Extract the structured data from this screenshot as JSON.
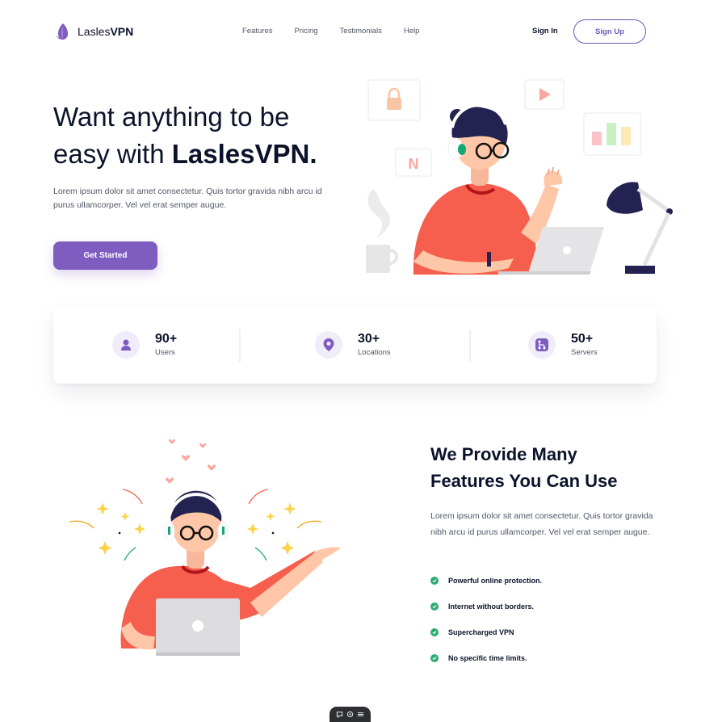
{
  "brand": {
    "name_light": "Lasles",
    "name_bold": "VPN",
    "color": "#7e5cc0"
  },
  "nav": {
    "items": [
      {
        "label": "Features"
      },
      {
        "label": "Pricing"
      },
      {
        "label": "Testimonials"
      },
      {
        "label": "Help"
      }
    ],
    "sign_in": "Sign In",
    "sign_up": "Sign Up"
  },
  "hero": {
    "title_line1": "Want anything to be",
    "title_line2_prefix": "easy with ",
    "title_line2_bold": "LaslesVPN.",
    "description": "Lorem ipsum dolor sit amet consectetur. Quis tortor gravida nibh arcu id purus ullamcorper. Vel vel erat semper augue.",
    "cta": "Get Started",
    "illustration_letter": "N"
  },
  "stats": [
    {
      "value": "90+",
      "label": "Users",
      "icon": "user-icon"
    },
    {
      "value": "30+",
      "label": "Locations",
      "icon": "location-icon"
    },
    {
      "value": "50+",
      "label": "Servers",
      "icon": "server-icon"
    }
  ],
  "features": {
    "title_line1": "We Provide Many",
    "title_line2": "Features You Can Use",
    "description": "Lorem ipsum dolor sit amet consectetur. Quis tortor gravida nibh arcu id purus ullamcorper. Vel vel erat semper augue.",
    "items": [
      {
        "label": "Powerful online protection."
      },
      {
        "label": "Internet without borders."
      },
      {
        "label": "Supercharged VPN"
      },
      {
        "label": "No specific time limits."
      }
    ]
  },
  "colors": {
    "accent": "#7e5cc0",
    "check": "#2fab73",
    "shirt": "#f65e4d",
    "heading": "#0b132a",
    "body": "#4f5665"
  }
}
